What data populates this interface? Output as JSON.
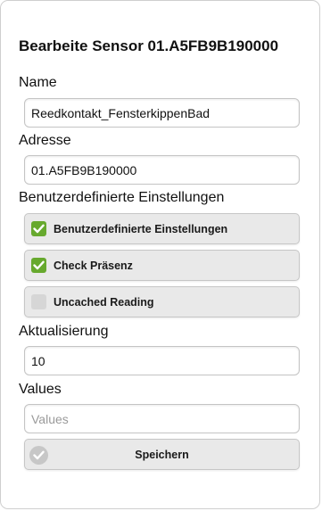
{
  "dialog": {
    "title": "Bearbeite Sensor 01.A5FB9B190000"
  },
  "form": {
    "name_label": "Name",
    "name_value": "Reedkontakt_FensterkippenBad",
    "address_label": "Adresse",
    "address_value": "01.A5FB9B190000",
    "custom_settings_label": "Benutzerdefinierte Einstellungen",
    "checkboxes": [
      {
        "label": "Benutzerdefinierte Einstellungen",
        "checked": true
      },
      {
        "label": "Check Präsenz",
        "checked": true
      },
      {
        "label": "Uncached Reading",
        "checked": false
      }
    ],
    "interval_label": "Aktualisierung",
    "interval_value": "10",
    "values_label": "Values",
    "values_placeholder": "Values",
    "save_label": "Speichern"
  },
  "colors": {
    "checked": "#67a92e",
    "unchecked": "#d6d6d6",
    "button_bg": "#e9e9e9"
  },
  "icons": {
    "checkbox_checked": "check-icon",
    "save": "check-circle-icon"
  }
}
